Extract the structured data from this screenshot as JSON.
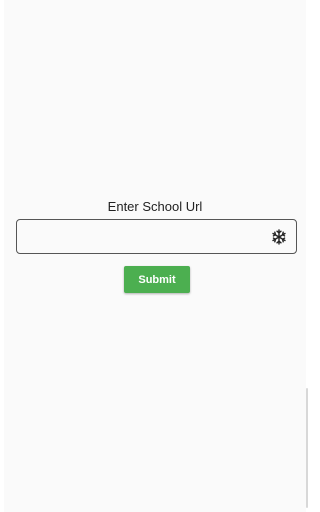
{
  "form": {
    "prompt_label": "Enter School Url",
    "url_value": "",
    "url_placeholder": "",
    "field_icon": "snowflake-icon",
    "submit_label": "Submit"
  },
  "colors": {
    "submit_background": "#4caf50",
    "submit_text": "#ffffff",
    "background": "#fafafa",
    "field_border": "#555555"
  }
}
